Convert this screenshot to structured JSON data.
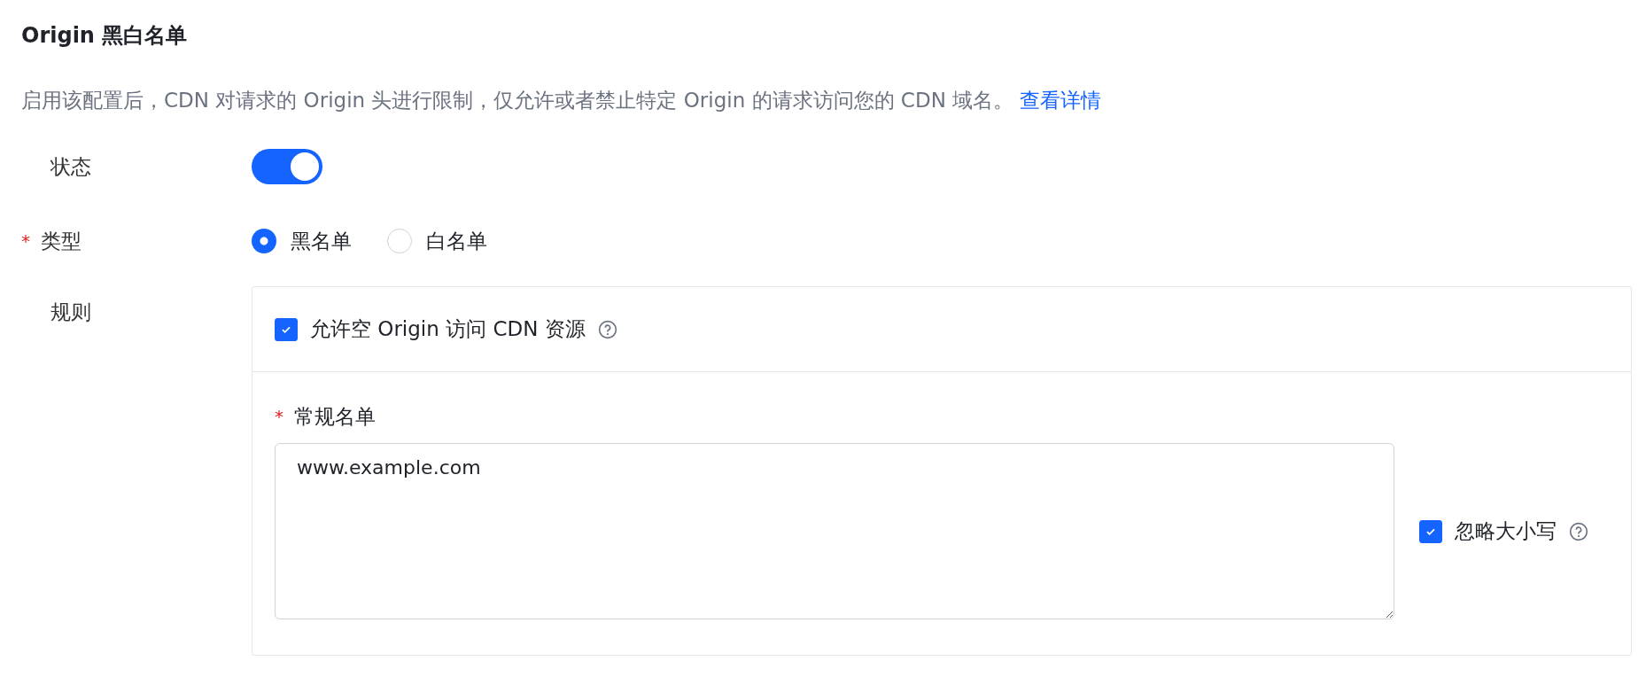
{
  "title": "Origin 黑白名单",
  "description": "启用该配置后，CDN 对请求的 Origin 头进行限制，仅允许或者禁止特定 Origin 的请求访问您的 CDN 域名。",
  "details_link": "查看详情",
  "status": {
    "label": "状态",
    "on": true
  },
  "type": {
    "label": "类型",
    "required": true,
    "required_mark": "*",
    "options": [
      {
        "label": "黑名单",
        "selected": true
      },
      {
        "label": "白名单",
        "selected": false
      }
    ]
  },
  "rules": {
    "label": "规则",
    "allow_empty": {
      "label": "允许空 Origin 访问 CDN 资源",
      "checked": true
    },
    "list": {
      "label": "常规名单",
      "required": true,
      "required_mark": "*",
      "value": "www.example.com"
    },
    "ignore_case": {
      "label": "忽略大小写",
      "checked": true
    }
  }
}
